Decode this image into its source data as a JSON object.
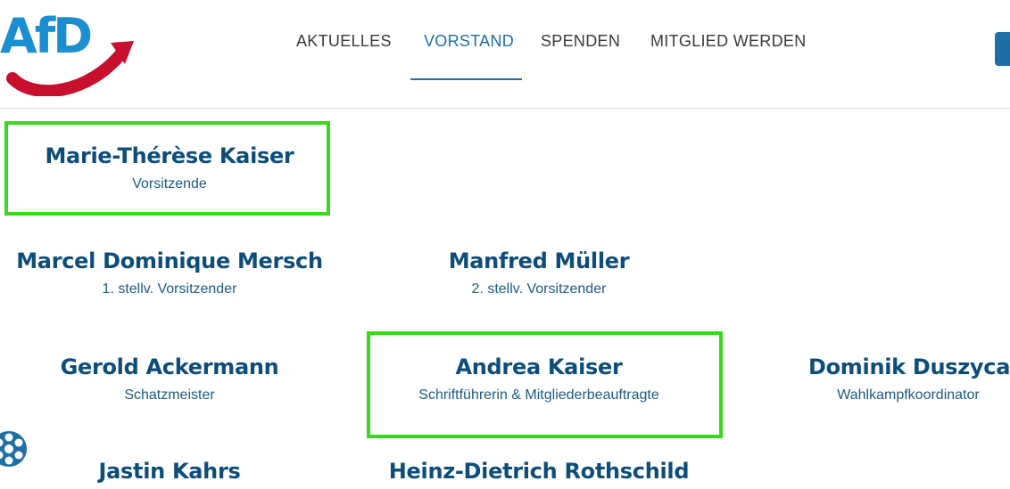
{
  "header": {
    "logo_text": "AfD",
    "nav": [
      {
        "label": "AKTUELLES",
        "active": false
      },
      {
        "label": "VORSTAND",
        "active": true
      },
      {
        "label": "SPENDEN",
        "active": false
      },
      {
        "label": "MITGLIED WERDEN",
        "active": false
      }
    ]
  },
  "board": [
    {
      "name": "Marie-Thérèse Kaiser",
      "role": "Vorsitzende",
      "highlighted": true
    },
    {
      "name": "Marcel Dominique Mersch",
      "role": "1. stellv. Vorsitzender",
      "highlighted": false
    },
    {
      "name": "Manfred Müller",
      "role": "2. stellv. Vorsitzender",
      "highlighted": false
    },
    {
      "name": "Gerold Ackermann",
      "role": "Schatzmeister",
      "highlighted": false
    },
    {
      "name": "Andrea Kaiser",
      "role": "Schriftführerin & Mitgliederbeauftragte",
      "highlighted": true
    },
    {
      "name": "Dominik Duszyca",
      "role": "Wahlkampfkoordinator",
      "highlighted": false
    },
    {
      "name": "Jastin Kahrs",
      "role": "",
      "highlighted": false
    },
    {
      "name": "Heinz-Dietrich Rothschild",
      "role": "",
      "highlighted": false
    }
  ],
  "colors": {
    "brand_blue": "#1a8ed1",
    "brand_red": "#c8102e",
    "name_color": "#0d4d7a",
    "highlight": "#3ad81c"
  },
  "icons": {
    "cookie": "cookie-settings-icon"
  }
}
